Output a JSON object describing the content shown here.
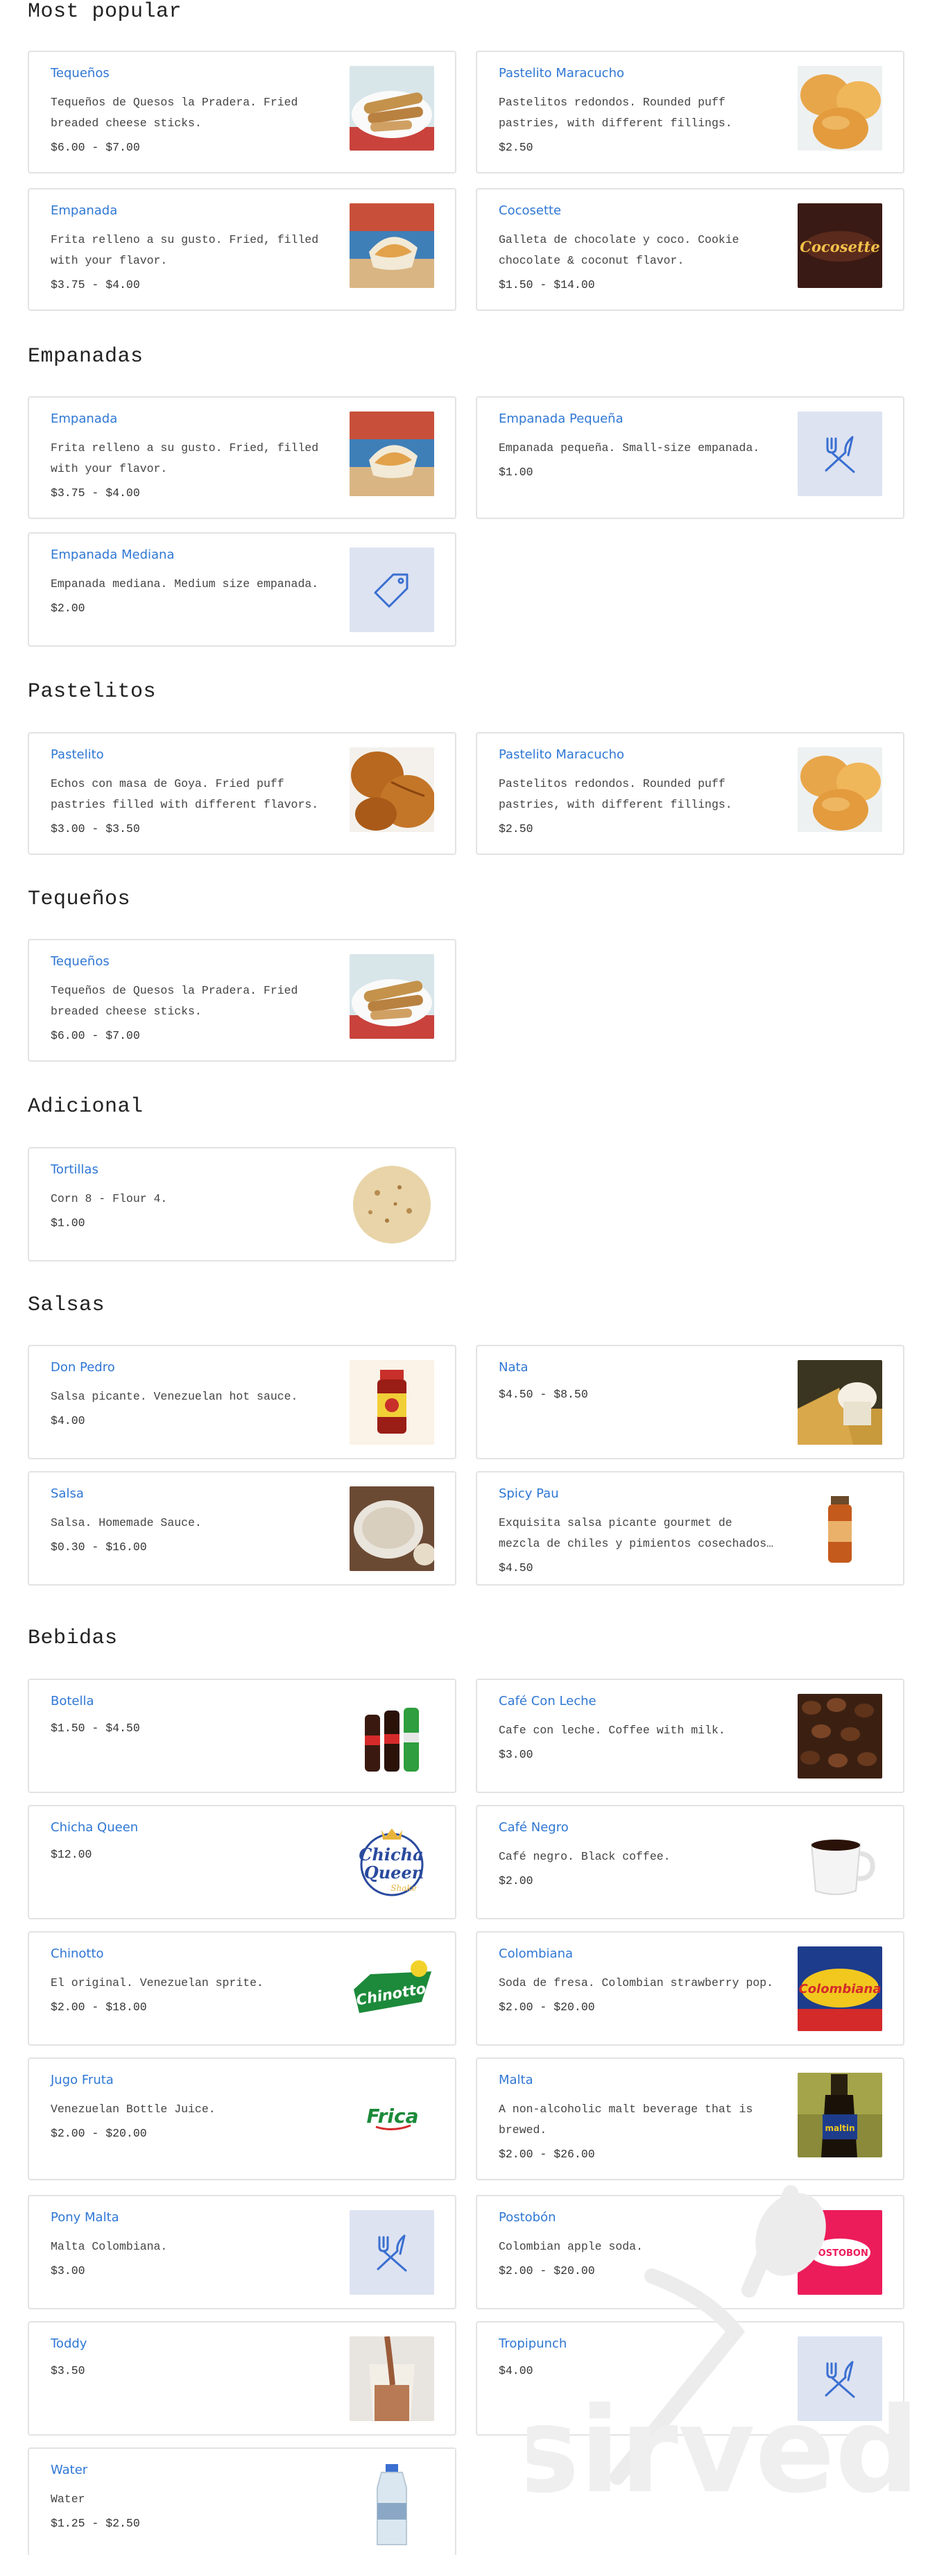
{
  "sections": {
    "popular": "Most popular",
    "empanadas": "Empanadas",
    "pastelitos": "Pastelitos",
    "tequenos": "Tequeños",
    "adicional": "Adicional",
    "salsas": "Salsas",
    "bebidas": "Bebidas"
  },
  "items": {
    "tequenos": {
      "name": "Tequeños",
      "desc": "Tequeños de Quesos la Pradera. Fried breaded cheese sticks.",
      "price": "$6.00 - $7.00"
    },
    "pastelito_maracucho": {
      "name": "Pastelito Maracucho",
      "desc": "Pastelitos redondos. Rounded puff pastries, with different fillings.",
      "price": "$2.50"
    },
    "empanada": {
      "name": "Empanada",
      "desc": "Frita relleno a su gusto. Fried, filled with your flavor.",
      "price": "$3.75 - $4.00"
    },
    "cocosette": {
      "name": "Cocosette",
      "desc": "Galleta de chocolate y coco. Cookie chocolate & coconut flavor.",
      "price": "$1.50 - $14.00"
    },
    "empanada_pequena": {
      "name": "Empanada Pequeña",
      "desc": "Empanada pequeña. Small-size empanada.",
      "price": "$1.00"
    },
    "empanada_mediana": {
      "name": "Empanada Mediana",
      "desc": "Empanada mediana. Medium size empanada.",
      "price": "$2.00"
    },
    "pastelito": {
      "name": "Pastelito",
      "desc": "Echos con masa de Goya. Fried puff pastries filled with different flavors.",
      "price": "$3.00 - $3.50"
    },
    "tortillas": {
      "name": "Tortillas",
      "desc": "Corn 8 - Flour 4.",
      "price": "$1.00"
    },
    "don_pedro": {
      "name": "Don Pedro",
      "desc": "Salsa picante. Venezuelan hot sauce.",
      "price": "$4.00"
    },
    "nata": {
      "name": "Nata",
      "desc": "",
      "price": "$4.50 - $8.50"
    },
    "salsa": {
      "name": "Salsa",
      "desc": "Salsa. Homemade Sauce.",
      "price": "$0.30 - $16.00"
    },
    "spicy_pau": {
      "name": "Spicy Pau",
      "desc": "Exquisita salsa picante gourmet de mezcla de chiles y pimientos cosechados…",
      "price": "$4.50"
    },
    "botella": {
      "name": "Botella",
      "desc": "",
      "price": "$1.50 - $4.50"
    },
    "cafe_con_leche": {
      "name": "Café Con Leche",
      "desc": "Cafe con leche. Coffee with milk.",
      "price": "$3.00"
    },
    "chicha_queen": {
      "name": "Chicha Queen",
      "desc": "",
      "price": "$12.00"
    },
    "cafe_negro": {
      "name": "Café Negro",
      "desc": "Café negro. Black coffee.",
      "price": "$2.00"
    },
    "chinotto": {
      "name": "Chinotto",
      "desc": "El original. Venezuelan sprite.",
      "price": "$2.00 - $18.00"
    },
    "colombiana": {
      "name": "Colombiana",
      "desc": "Soda de fresa. Colombian strawberry pop.",
      "price": "$2.00 - $20.00"
    },
    "jugo_fruta": {
      "name": "Jugo Fruta",
      "desc": "Venezuelan Bottle Juice.",
      "price": "$2.00 - $20.00"
    },
    "malta": {
      "name": "Malta",
      "desc": "A non-alcoholic malt beverage that is brewed.",
      "price": "$2.00 - $26.00"
    },
    "pony_malta": {
      "name": "Pony Malta",
      "desc": "Malta Colombiana.",
      "price": "$3.00"
    },
    "postobon": {
      "name": "Postobón",
      "desc": "Colombian apple soda.",
      "price": "$2.00 - $20.00"
    },
    "toddy": {
      "name": "Toddy",
      "desc": "",
      "price": "$3.50"
    },
    "tropipunch": {
      "name": "Tropipunch",
      "desc": "",
      "price": "$4.00"
    },
    "water": {
      "name": "Water",
      "desc": "Water",
      "price": "$1.25 - $2.50"
    }
  },
  "logos": {
    "cocosette": "Cocosette",
    "chicha_queen_1": "Chicha",
    "chicha_queen_2": "Queen",
    "chicha_queen_3": "Shake",
    "chinotto": "Chinotto",
    "frica": "Frica",
    "colombiana": "Colombiana",
    "maltin": "maltin",
    "postobon": "POSTOBON",
    "watermark": "sirved"
  },
  "colors": {
    "link": "#2f77d4",
    "border": "#e3e3e3",
    "placeholder_bg": "#dde3f1",
    "placeholder_icon": "#3a6fd0"
  }
}
